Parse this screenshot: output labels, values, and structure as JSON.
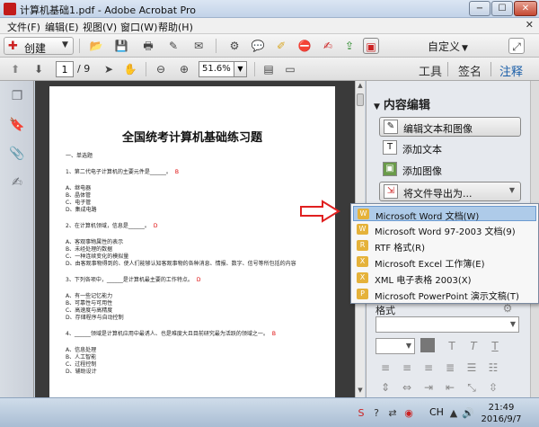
{
  "window": {
    "title": "计算机基础1.pdf - Adobe Acrobat Pro",
    "minimize_label": "−",
    "maximize_label": "☐",
    "close_label": "✕"
  },
  "menu": {
    "items": [
      "文件(F)",
      "编辑(E)",
      "视图(V)",
      "窗口(W)",
      "帮助(H)"
    ],
    "close_label": "✕"
  },
  "toolbar1": {
    "create_label": "创建",
    "custom_label": "自定义"
  },
  "toolbar2": {
    "current_page": "1",
    "page_total": "/ 9",
    "zoom": "51.6%",
    "tabs": [
      "工具",
      "签名",
      "注释"
    ]
  },
  "document": {
    "title": "全国统考计算机基础练习题",
    "lines": [
      {
        "text": "一、单选题",
        "mark": ""
      },
      {
        "text": "1、第二代电子计算机的主要元件是______。",
        "mark": "B"
      },
      {
        "text": "A、继电器",
        "mark": ""
      },
      {
        "text": "B、晶体管",
        "mark": ""
      },
      {
        "text": "C、电子管",
        "mark": ""
      },
      {
        "text": "D、集成电路",
        "mark": ""
      },
      {
        "text": "2、在计算机领域，信息是______。",
        "mark": "D"
      },
      {
        "text": "A、客观事物属性的表示",
        "mark": ""
      },
      {
        "text": "B、未经处理的数据",
        "mark": ""
      },
      {
        "text": "C、一种连续变化的模拟量",
        "mark": ""
      },
      {
        "text": "D、由客观事物得到的、使人们能够认知客观事物的各种消息、情报、数字、信号等所包括的内容",
        "mark": ""
      },
      {
        "text": "3、下列各项中，______是计算机最主要的工作特点。",
        "mark": "D"
      },
      {
        "text": "A、有一些记忆能力",
        "mark": ""
      },
      {
        "text": "B、可靠性与可用性",
        "mark": ""
      },
      {
        "text": "C、高速度与高精度",
        "mark": ""
      },
      {
        "text": "D、存储程序与自动控制",
        "mark": ""
      },
      {
        "text": "4、______领域是计算机应用中最诱人、也是难度大且目前研究最为活跃的领域之一。",
        "mark": "B"
      },
      {
        "text": "A、信息处理",
        "mark": ""
      },
      {
        "text": "B、人工智能",
        "mark": ""
      },
      {
        "text": "C、过程控制",
        "mark": ""
      },
      {
        "text": "D、辅助设计",
        "mark": ""
      }
    ]
  },
  "right_panel": {
    "section_title": "内容编辑",
    "items": [
      {
        "label": "编辑文本和图像",
        "icon": "edit-text-image-icon",
        "style": "button"
      },
      {
        "label": "添加文本",
        "icon": "add-text-icon",
        "style": "plain"
      },
      {
        "label": "添加图像",
        "icon": "add-image-icon",
        "style": "plain"
      },
      {
        "label": "将文件导出为...",
        "icon": "export-file-icon",
        "style": "button"
      }
    ],
    "lower_label": "格式"
  },
  "export_menu": {
    "items": [
      {
        "label": "Microsoft Word 文档(W)",
        "selected": true
      },
      {
        "label": "Microsoft Word 97-2003 文档(9)",
        "selected": false
      },
      {
        "label": "RTF 格式(R)",
        "selected": false
      },
      {
        "label": "Microsoft Excel 工作簿(E)",
        "selected": false
      },
      {
        "label": "XML 电子表格 2003(X)",
        "selected": false
      },
      {
        "label": "Microsoft PowerPoint 演示文稿(T)",
        "selected": false
      }
    ]
  },
  "taskbar": {
    "lang": "CH",
    "time": "21:49",
    "date": "2016/9/7"
  }
}
